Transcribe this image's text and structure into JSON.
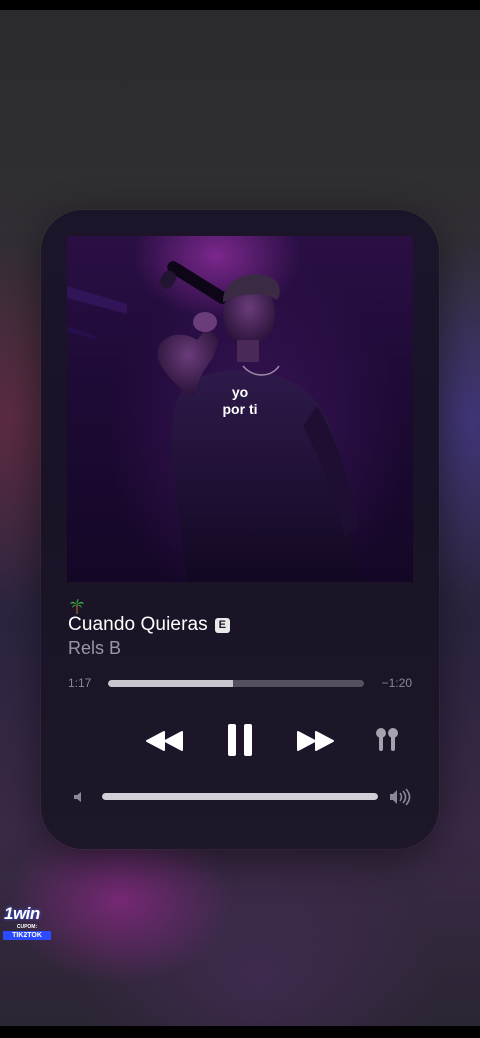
{
  "album_art": {
    "caption_line1": "yo",
    "caption_line2": "por ti"
  },
  "now_playing": {
    "emoji_icon": "palm-tree-icon",
    "title": "Cuando Quieras",
    "explicit_badge": "E",
    "artist": "Rels B"
  },
  "progress": {
    "elapsed": "1:17",
    "remaining": "−1:20",
    "fraction": 0.49
  },
  "controls": {
    "rewind_icon": "rewind-icon",
    "pause_icon": "pause-icon",
    "forward_icon": "fast-forward-icon",
    "output_icon": "airpods-icon"
  },
  "volume": {
    "low_icon": "speaker-low-icon",
    "high_icon": "speaker-high-icon",
    "fraction": 1.0
  },
  "promo": {
    "logo": "1win",
    "cupom_label": "CUPOM:",
    "code": "TIK2TOK"
  },
  "colors": {
    "card_bg": "#1c1428",
    "text_primary": "#ffffff",
    "text_secondary": "#9c95a8",
    "track": "#55505f",
    "track_fill": "#c9c6cf",
    "promo_blue": "#2a4bff"
  }
}
